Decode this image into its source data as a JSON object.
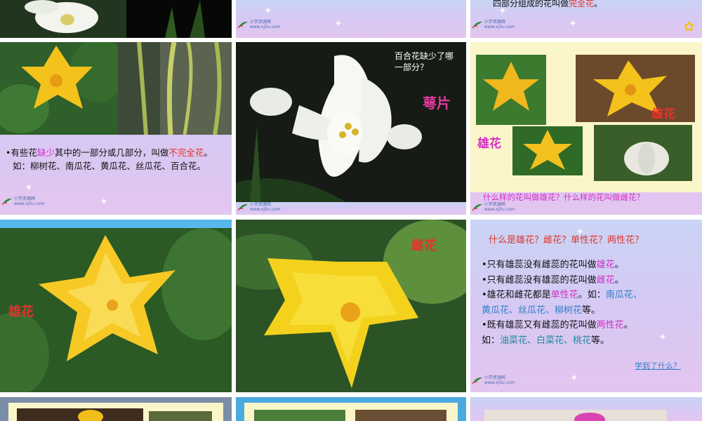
{
  "row1": {
    "slide2_text_partial": "",
    "slide3_text": "四部分组成的花叫做",
    "slide3_highlight": "完全花",
    "slide3_end": "。"
  },
  "logo": {
    "line1": "小学资源网",
    "line2": "www.xj5u.com"
  },
  "slide_incomplete": {
    "bullet": "•有些花",
    "lack": "缺少",
    "mid": "其中的一部分或几部分，叫做",
    "term": "不完全花",
    "end": "。",
    "examples": "如：柳树花、南瓜花、黄瓜花、丝瓜花、百合花。"
  },
  "slide_lily": {
    "question_line1": "百合花缺少了哪",
    "question_line2": "一部分？",
    "answer": "萼片"
  },
  "slide_male_female": {
    "female_label": "雌花",
    "male_label": "雄花",
    "question": "什么样的花叫做雄花？什么样的花叫做雌花？"
  },
  "slide_male_big": {
    "label": "雄花"
  },
  "slide_female_big": {
    "label": "雌花"
  },
  "slide_summary": {
    "title": "什么是雄花？雌花？单性花？两性花？",
    "l1_a": "•只有雄蕊没有雌蕊的花叫做",
    "l1_b": "雄花",
    "l1_c": "。",
    "l2_a": "•只有雌蕊没有雄蕊的花叫做",
    "l2_b": "雌花",
    "l2_c": "。",
    "l3_a": "•雄花和雌花都是",
    "l3_b": "单性花",
    "l3_c": "。如：",
    "l3_d": "南瓜花、",
    "l4_a": "黄瓜花、丝瓜花、柳树花",
    "l4_b": "等。",
    "l5_a": "•既有雄蕊又有雌蕊的花叫做",
    "l5_b": "两性花",
    "l5_c": "。",
    "l6_a": "如：",
    "l6_b": "油菜花、白菜花、桃花",
    "l6_c": "等。",
    "link": "学到了什么？"
  },
  "colors": {
    "accent_red": "#e2342a",
    "accent_magenta": "#d42ec7",
    "accent_blue": "#2f7fc8",
    "flower_yellow": "#f4c21a"
  }
}
